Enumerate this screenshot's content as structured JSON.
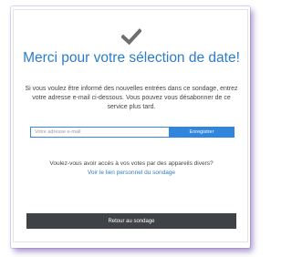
{
  "confirmation": {
    "icon": "check-icon",
    "title": "Merci pour votre sélection de date!",
    "description": "Si vous voulez être informé des nouvelles entrées dans ce sondage, entrez votre adresse e-mail ci-dessous. Vous pouvez vous désabonner de ce service plus tard.",
    "email": {
      "placeholder": "Votre adresse e-mail",
      "value": ""
    },
    "save_label": "Enregistrer",
    "question": "Voulez-vous avoir accès à vos votes par des appareils divers?",
    "personal_link_label": "Voir le lien personnel du sondage",
    "back_label": "Retour au sondage"
  },
  "colors": {
    "accent": "#2c7cc9",
    "button_primary": "#2f86dc",
    "button_dark": "#3f4247",
    "check_icon": "#6e6e6e",
    "frame_shadow": "#5f3ca0"
  }
}
